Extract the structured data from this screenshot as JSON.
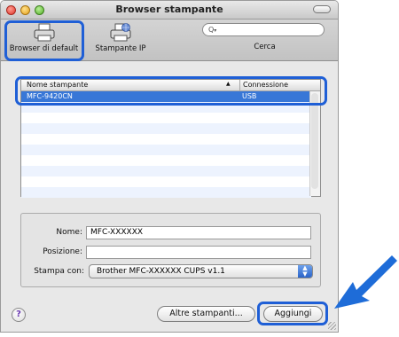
{
  "window": {
    "title": "Browser stampante"
  },
  "toolbar": {
    "items": [
      {
        "label": "Browser di default",
        "icon": "printer-icon"
      },
      {
        "label": "Stampante IP",
        "icon": "network-printer-icon"
      }
    ],
    "search": {
      "placeholder": "",
      "label": "Cerca",
      "icon": "magnifier-icon"
    }
  },
  "printer_list": {
    "columns": [
      "Nome stampante",
      "Connessione"
    ],
    "sort_indicator": "▲",
    "rows": [
      {
        "name": "MFC-9420CN",
        "connection": "USB",
        "selected": true
      }
    ]
  },
  "form": {
    "name_label": "Nome:",
    "name_value": "MFC-XXXXXX",
    "location_label": "Posizione:",
    "location_value": "",
    "print_with_label": "Stampa con:",
    "print_with_value": "Brother MFC-XXXXXX CUPS v1.1"
  },
  "buttons": {
    "help": "?",
    "more_printers": "Altre stampanti...",
    "add": "Aggiungi"
  },
  "colors": {
    "highlight": "#1f5fd6",
    "selection": "#3877d7",
    "arrow": "#1e6cd8"
  }
}
